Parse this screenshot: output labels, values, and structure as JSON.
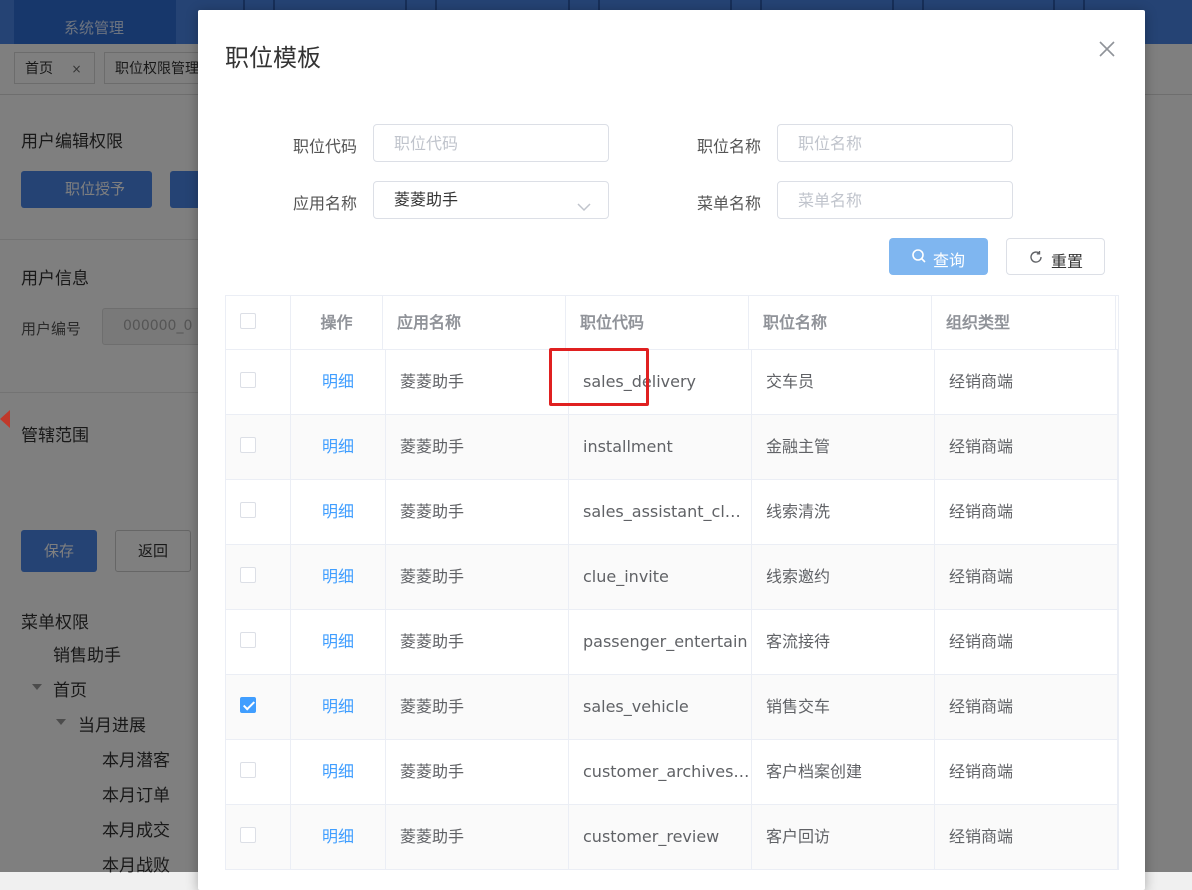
{
  "background": {
    "nav_active_label": "系统管理",
    "tabs": [
      {
        "label": "首页",
        "close": "×"
      },
      {
        "label": "职位权限管理"
      }
    ],
    "section_user_edit": "用户编辑权限",
    "btn_grant": "职位授予",
    "section_user_info": "用户信息",
    "user_no_label": "用户编号",
    "user_no_value": "000000_0",
    "section_scope": "管辖范围",
    "btn_save": "保存",
    "btn_back": "返回",
    "menu_perm_title": "菜单权限",
    "tree": [
      "销售助手",
      "首页",
      "当月进展",
      "本月潜客",
      "本月订单",
      "本月成交",
      "本月战败"
    ]
  },
  "modal": {
    "title": "职位模板",
    "filters": {
      "position_code_label": "职位代码",
      "position_code_placeholder": "职位代码",
      "position_name_label": "职位名称",
      "position_name_placeholder": "职位名称",
      "app_name_label": "应用名称",
      "app_name_value": "菱菱助手",
      "menu_name_label": "菜单名称",
      "menu_name_placeholder": "菜单名称"
    },
    "btn_query": "查询",
    "btn_reset": "重置",
    "table": {
      "headers": [
        "操作",
        "应用名称",
        "职位代码",
        "职位名称",
        "组织类型"
      ],
      "rows": [
        {
          "action": "明细",
          "app": "菱菱助手",
          "code": "sales_delivery",
          "name": "交车员",
          "org": "经销商端",
          "checked": false
        },
        {
          "action": "明细",
          "app": "菱菱助手",
          "code": "installment",
          "name": "金融主管",
          "org": "经销商端",
          "checked": false
        },
        {
          "action": "明细",
          "app": "菱菱助手",
          "code": "sales_assistant_cl…",
          "name": "线索清洗",
          "org": "经销商端",
          "checked": false
        },
        {
          "action": "明细",
          "app": "菱菱助手",
          "code": "clue_invite",
          "name": "线索邀约",
          "org": "经销商端",
          "checked": false
        },
        {
          "action": "明细",
          "app": "菱菱助手",
          "code": "passenger_entertain",
          "name": "客流接待",
          "org": "经销商端",
          "checked": false
        },
        {
          "action": "明细",
          "app": "菱菱助手",
          "code": "sales_vehicle",
          "name": "销售交车",
          "org": "经销商端",
          "checked": true
        },
        {
          "action": "明细",
          "app": "菱菱助手",
          "code": "customer_archives…",
          "name": "客户档案创建",
          "org": "经销商端",
          "checked": false
        },
        {
          "action": "明细",
          "app": "菱菱助手",
          "code": "customer_review",
          "name": "客户回访",
          "org": "经销商端",
          "checked": false
        }
      ]
    }
  },
  "colors": {
    "primary": "#409eff",
    "highlight": "#e02020",
    "nav": "#4a86e8"
  }
}
